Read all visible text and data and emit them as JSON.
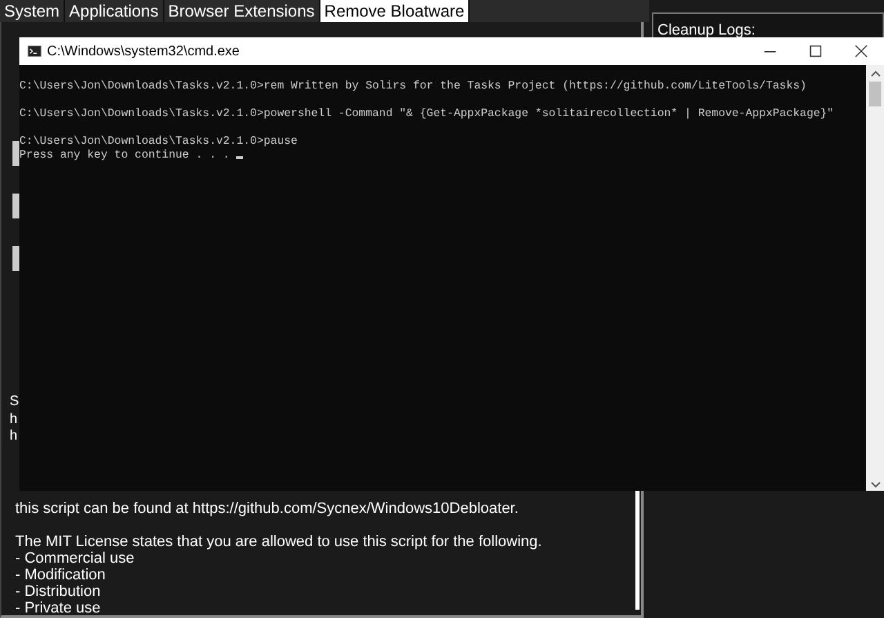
{
  "tabs": [
    {
      "label": "System",
      "selected": false
    },
    {
      "label": "Applications",
      "selected": false
    },
    {
      "label": "Browser Extensions",
      "selected": false
    },
    {
      "label": "Remove Bloatware",
      "selected": true
    }
  ],
  "logs_panel": {
    "title": "Cleanup Logs:"
  },
  "main_panel": {
    "fragments": [
      "S",
      "h",
      "h"
    ],
    "paragraphs": [
      [
        "this script can be found at https://github.com/Sycnex/Windows10Debloater."
      ],
      [
        "The MIT License states that you are allowed to use this script for the following.",
        " - Commercial use",
        " - Modification",
        " - Distribution",
        " - Private use"
      ]
    ]
  },
  "console": {
    "title": "C:\\Windows\\system32\\cmd.exe",
    "lines": [
      {
        "kind": "command",
        "text": "C:\\Users\\Jon\\Downloads\\Tasks.v2.1.0>rem Written by Solirs for the Tasks Project (https://github.com/LiteTools/Tasks)",
        "cursor": false
      },
      {
        "kind": "command",
        "text": "C:\\Users\\Jon\\Downloads\\Tasks.v2.1.0>powershell -Command \"& {Get-AppxPackage *solitairecollection* | Remove-AppxPackage}\"",
        "cursor": false
      },
      {
        "kind": "command",
        "text": "C:\\Users\\Jon\\Downloads\\Tasks.v2.1.0>pause",
        "cursor": false
      },
      {
        "kind": "output",
        "text": "Press any key to continue . . .",
        "cursor": true
      }
    ]
  }
}
